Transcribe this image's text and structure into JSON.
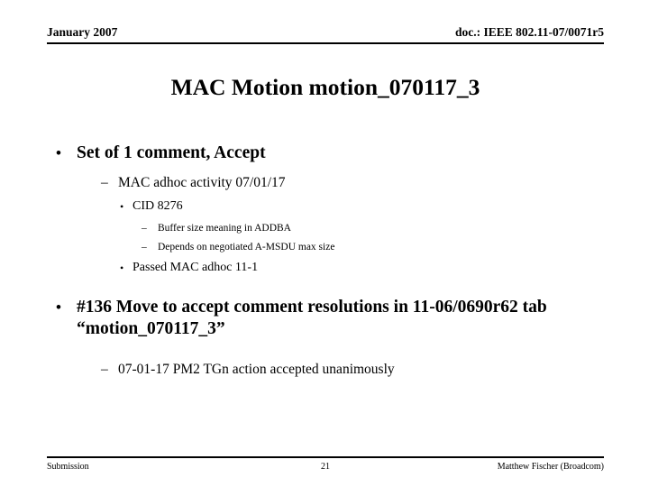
{
  "header": {
    "left": "January 2007",
    "right": "doc.: IEEE 802.11-07/0071r5"
  },
  "title": "MAC Motion motion_070117_3",
  "bullets": [
    {
      "level": 1,
      "marker": "•",
      "text": "Set of 1 comment, Accept"
    },
    {
      "level": 2,
      "marker": "–",
      "text": "MAC adhoc activity 07/01/17"
    },
    {
      "level": 3,
      "marker": "•",
      "text": "CID 8276"
    },
    {
      "level": 4,
      "marker": "–",
      "text": "Buffer size meaning in ADDBA"
    },
    {
      "level": 4,
      "marker": "–",
      "text": "Depends on negotiated A-MSDU max size"
    },
    {
      "level": 3,
      "marker": "•",
      "text": "Passed MAC adhoc 11-1"
    },
    {
      "level": 1,
      "marker": "•",
      "text": "#136 Move to accept comment resolutions in 11-06/0690r62 tab “motion_070117_3”"
    },
    {
      "level": 2,
      "marker": "–",
      "text": "07-01-17 PM2 TGn action accepted unanimously"
    }
  ],
  "footer": {
    "left": "Submission",
    "page": "21",
    "right": "Matthew Fischer (Broadcom)"
  },
  "colors": {
    "background": "#ffffff",
    "text": "#000000",
    "rule": "#000000"
  }
}
